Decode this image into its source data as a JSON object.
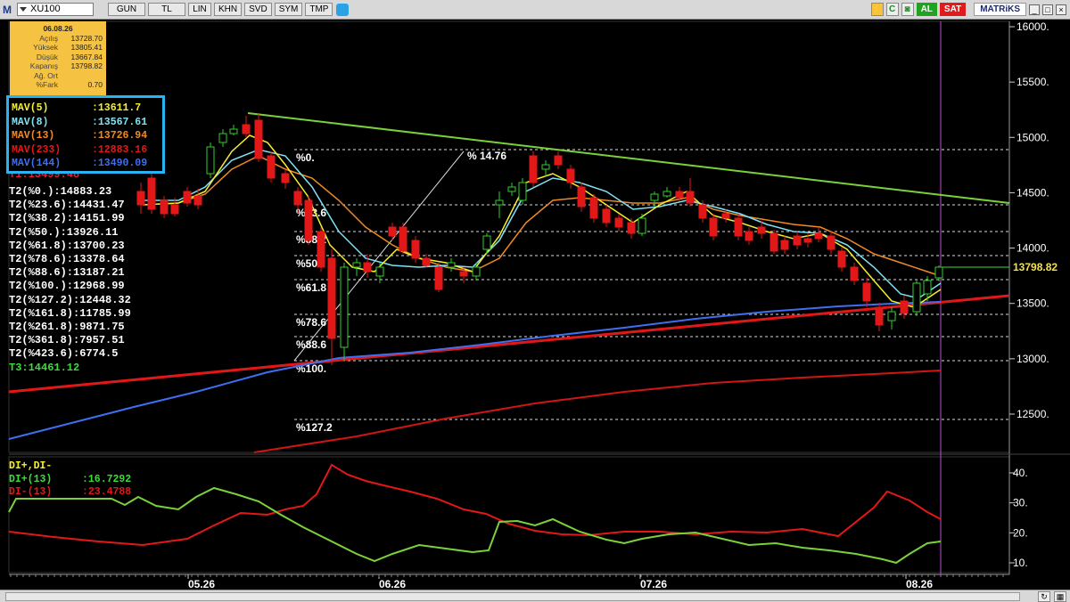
{
  "toolbar": {
    "logo": "M",
    "symbol": "XU100",
    "buttons": [
      "GUN",
      "TL",
      "LIN",
      "KHN",
      "SVD",
      "SYM",
      "TMP"
    ],
    "al_label": "AL",
    "sat_label": "SAT",
    "brand": "MATRiKS",
    "icon_c": "C",
    "colors": {
      "al": "#1fa321",
      "sat": "#e01b1b"
    }
  },
  "info_box": {
    "date": "06.08.26",
    "rows": [
      {
        "label": "Açılış",
        "value": "13728.70"
      },
      {
        "label": "Yüksek",
        "value": "13805.41"
      },
      {
        "label": "Düşük",
        "value": "13667.84"
      },
      {
        "label": "Kapanış",
        "value": "13798.82"
      },
      {
        "label": "Ağ. Ort",
        "value": ""
      },
      {
        "label": "%Fark",
        "value": "0.70"
      }
    ]
  },
  "mav_legend": [
    {
      "name": "MAV(5)",
      "value": ":13611.7",
      "color": "#f7ef2e"
    },
    {
      "name": "MAV(8)",
      "value": ":13567.61",
      "color": "#7fe3f5"
    },
    {
      "name": "MAV(13)",
      "value": ":13726.94",
      "color": "#f08a24"
    },
    {
      "name": "MAV(233)",
      "value": ":12883.16",
      "color": "#e21818"
    },
    {
      "name": "MAV(144)",
      "value": ":13490.09",
      "color": "#3f6ff0"
    }
  ],
  "fib_list": {
    "partial_top": "T1:13499.48",
    "rows": [
      "T2(%0.):14883.23",
      "T2(%23.6):14431.47",
      "T2(%38.2):14151.99",
      "T2(%50.):13926.11",
      "T2(%61.8):13700.23",
      "T2(%78.6):13378.64",
      "T2(%88.6):13187.21",
      "T2(%100.):12968.99",
      "T2(%127.2):12448.32",
      "T2(%161.8):11785.99",
      "T2(%261.8):9871.75",
      "T2(%361.8):7957.51",
      "T2(%423.6):6774.5"
    ],
    "t3": "T3:14461.12"
  },
  "fib_levels": [
    "%0.",
    "%23.6",
    "%38.2",
    "%50.",
    "%61.8",
    "%78.6",
    "%88.6",
    "%100.",
    "%127.2"
  ],
  "fib_move_label": "% 14.76",
  "price_axis": [
    "16000.",
    "15500.",
    "15000.",
    "14500.",
    "14000.",
    "13500.",
    "13000.",
    "12500."
  ],
  "last_price": "13798.82",
  "di_panel": {
    "title": "DI+,DI-",
    "di_plus": {
      "name": "DI+(13)",
      "value": ":16.7292"
    },
    "di_minus": {
      "name": "DI-(13)",
      "value": ":23.4788"
    },
    "axis": [
      "40.",
      "30.",
      "20.",
      "10."
    ]
  },
  "date_axis": [
    "05.26",
    "06.26",
    "07.26",
    "08.26"
  ]
}
